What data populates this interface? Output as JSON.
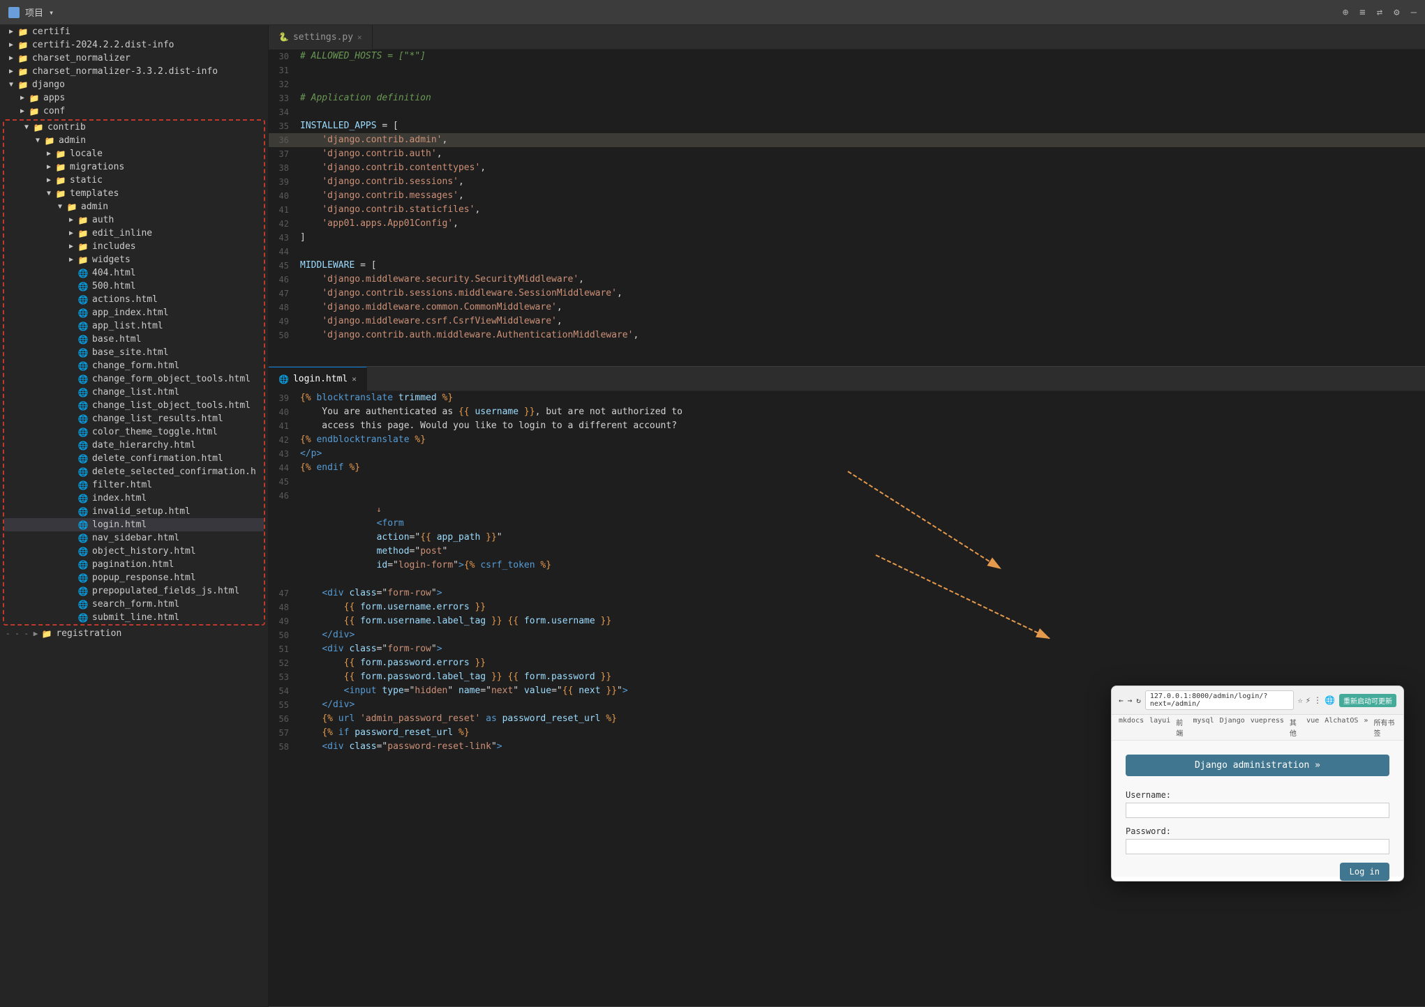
{
  "topbar": {
    "project_label": "项目",
    "dropdown_icon": "▾",
    "icons": [
      "⊕",
      "≡",
      "⇄",
      "⚙",
      "—"
    ]
  },
  "sidebar": {
    "items": [
      {
        "level": 0,
        "type": "folder",
        "name": "certifi",
        "expanded": false
      },
      {
        "level": 0,
        "type": "folder",
        "name": "certifi-2024.2.2.dist-info",
        "expanded": false
      },
      {
        "level": 0,
        "type": "folder",
        "name": "charset_normalizer",
        "expanded": false
      },
      {
        "level": 0,
        "type": "folder",
        "name": "charset_normalizer-3.3.2.dist-info",
        "expanded": false
      },
      {
        "level": 0,
        "type": "folder",
        "name": "django",
        "expanded": true
      },
      {
        "level": 1,
        "type": "folder",
        "name": "apps",
        "expanded": false
      },
      {
        "level": 1,
        "type": "folder",
        "name": "conf",
        "expanded": false
      },
      {
        "level": 1,
        "type": "folder",
        "name": "contrib",
        "expanded": true
      },
      {
        "level": 2,
        "type": "folder",
        "name": "admin",
        "expanded": true,
        "dashed": true
      },
      {
        "level": 3,
        "type": "folder",
        "name": "locale",
        "expanded": false
      },
      {
        "level": 3,
        "type": "folder",
        "name": "migrations",
        "expanded": false
      },
      {
        "level": 3,
        "type": "folder",
        "name": "static",
        "expanded": false
      },
      {
        "level": 3,
        "type": "folder",
        "name": "templates",
        "expanded": true
      },
      {
        "level": 4,
        "type": "folder",
        "name": "admin",
        "expanded": true
      },
      {
        "level": 5,
        "type": "folder",
        "name": "auth",
        "expanded": false
      },
      {
        "level": 5,
        "type": "folder",
        "name": "edit_inline",
        "expanded": false
      },
      {
        "level": 5,
        "type": "folder",
        "name": "includes",
        "expanded": false
      },
      {
        "level": 5,
        "type": "folder",
        "name": "widgets",
        "expanded": false
      },
      {
        "level": 5,
        "type": "file",
        "name": "404.html"
      },
      {
        "level": 5,
        "type": "file",
        "name": "500.html"
      },
      {
        "level": 5,
        "type": "file",
        "name": "actions.html"
      },
      {
        "level": 5,
        "type": "file",
        "name": "app_index.html"
      },
      {
        "level": 5,
        "type": "file",
        "name": "app_list.html"
      },
      {
        "level": 5,
        "type": "file",
        "name": "base.html"
      },
      {
        "level": 5,
        "type": "file",
        "name": "base_site.html"
      },
      {
        "level": 5,
        "type": "file",
        "name": "change_form.html"
      },
      {
        "level": 5,
        "type": "file",
        "name": "change_form_object_tools.html"
      },
      {
        "level": 5,
        "type": "file",
        "name": "change_list.html"
      },
      {
        "level": 5,
        "type": "file",
        "name": "change_list_object_tools.html"
      },
      {
        "level": 5,
        "type": "file",
        "name": "change_list_results.html"
      },
      {
        "level": 5,
        "type": "file",
        "name": "color_theme_toggle.html"
      },
      {
        "level": 5,
        "type": "file",
        "name": "date_hierarchy.html"
      },
      {
        "level": 5,
        "type": "file",
        "name": "delete_confirmation.html"
      },
      {
        "level": 5,
        "type": "file",
        "name": "delete_selected_confirmation.h"
      },
      {
        "level": 5,
        "type": "file",
        "name": "filter.html"
      },
      {
        "level": 5,
        "type": "file",
        "name": "index.html"
      },
      {
        "level": 5,
        "type": "file",
        "name": "invalid_setup.html"
      },
      {
        "level": 5,
        "type": "file",
        "name": "login.html",
        "selected": true
      },
      {
        "level": 5,
        "type": "file",
        "name": "nav_sidebar.html"
      },
      {
        "level": 5,
        "type": "file",
        "name": "object_history.html"
      },
      {
        "level": 5,
        "type": "file",
        "name": "pagination.html"
      },
      {
        "level": 5,
        "type": "file",
        "name": "popup_response.html"
      },
      {
        "level": 5,
        "type": "file",
        "name": "prepopulated_fields_js.html"
      },
      {
        "level": 5,
        "type": "file",
        "name": "search_form.html"
      },
      {
        "level": 5,
        "type": "file",
        "name": "submit_line.html"
      },
      {
        "level": 0,
        "type": "folder",
        "name": "registration",
        "expanded": false
      }
    ]
  },
  "editor": {
    "tabs": [
      {
        "name": "settings.py",
        "active": false,
        "icon": "🐍"
      },
      {
        "name": "login.html",
        "active": true,
        "icon": "🌐"
      }
    ]
  },
  "settings_lines": [
    {
      "num": 30,
      "content": "# ALLOWED_HOSTS = [\"*\"]",
      "type": "comment"
    },
    {
      "num": 31,
      "content": ""
    },
    {
      "num": 32,
      "content": ""
    },
    {
      "num": 33,
      "content": "# Application definition",
      "type": "comment"
    },
    {
      "num": 34,
      "content": ""
    },
    {
      "num": 35,
      "content": "INSTALLED_APPS = ["
    },
    {
      "num": 36,
      "content": "    'django.contrib.admin',",
      "highlight": true
    },
    {
      "num": 37,
      "content": "    'django.contrib.auth',"
    },
    {
      "num": 38,
      "content": "    'django.contrib.contenttypes',"
    },
    {
      "num": 39,
      "content": "    'django.contrib.sessions',"
    },
    {
      "num": 40,
      "content": "    'django.contrib.messages',"
    },
    {
      "num": 41,
      "content": "    'django.contrib.staticfiles',"
    },
    {
      "num": 42,
      "content": "    'app01.apps.App01Config',"
    },
    {
      "num": 43,
      "content": "]"
    },
    {
      "num": 44,
      "content": ""
    },
    {
      "num": 45,
      "content": "MIDDLEWARE = ["
    },
    {
      "num": 46,
      "content": "    'django.middleware.security.SecurityMiddleware',"
    },
    {
      "num": 47,
      "content": "    'django.contrib.sessions.middleware.SessionMiddleware',"
    },
    {
      "num": 48,
      "content": "    'django.middleware.common.CommonMiddleware',"
    },
    {
      "num": 49,
      "content": "    'django.middleware.csrf.CsrfViewMiddleware',"
    },
    {
      "num": 50,
      "content": "    'django.contrib.auth.middleware.AuthenticationMiddleware',"
    }
  ],
  "login_lines": [
    {
      "num": 39,
      "content": "{% blocktranslate trimmed %}"
    },
    {
      "num": 40,
      "content": "    You are authenticated as {{ username }}, but are not authorized to"
    },
    {
      "num": 41,
      "content": "    access this page. Would you like to login to a different account?"
    },
    {
      "num": 42,
      "content": "{% endblocktranslate %}"
    },
    {
      "num": 43,
      "content": "</p>"
    },
    {
      "num": 44,
      "content": "{% endif %}"
    },
    {
      "num": 45,
      "content": ""
    },
    {
      "num": 46,
      "content": "<form action=\"{{ app_path }}\" method=\"post\" id=\"login-form\">{% csrf_token %}"
    },
    {
      "num": 47,
      "content": "    <div class=\"form-row\">"
    },
    {
      "num": 48,
      "content": "        {{ form.username.errors }}"
    },
    {
      "num": 49,
      "content": "        {{ form.username.label_tag }} {{ form.username }}"
    },
    {
      "num": 50,
      "content": "    </div>"
    },
    {
      "num": 51,
      "content": "    <div class=\"form-row\">"
    },
    {
      "num": 52,
      "content": "        {{ form.password.errors }}"
    },
    {
      "num": 53,
      "content": "        {{ form.password.label_tag }} {{ form.password }}"
    },
    {
      "num": 54,
      "content": "        <input type=\"hidden\" name=\"next\" value=\"{{ next }}\">"
    },
    {
      "num": 55,
      "content": "    </div>"
    },
    {
      "num": 56,
      "content": "    {% url 'admin_password_reset' as password_reset_url %}"
    },
    {
      "num": 57,
      "content": "    {% if password_reset_url %}"
    },
    {
      "num": 58,
      "content": "    <div class=\"password-reset-link\">"
    }
  ],
  "browser": {
    "url": "127.0.0.1:8000/admin/login/?next=/admin/",
    "bookmarks": [
      "mkdocs",
      "layui",
      "前端",
      "mysql",
      "Django",
      "vuepress",
      "其他",
      "vue",
      "AlchatOS",
      "»",
      "所有书签"
    ],
    "title_btn": "Django administration »",
    "username_label": "Username:",
    "password_label": "Password:",
    "login_btn": "Log in",
    "restart_btn": "重新启动可更新"
  }
}
